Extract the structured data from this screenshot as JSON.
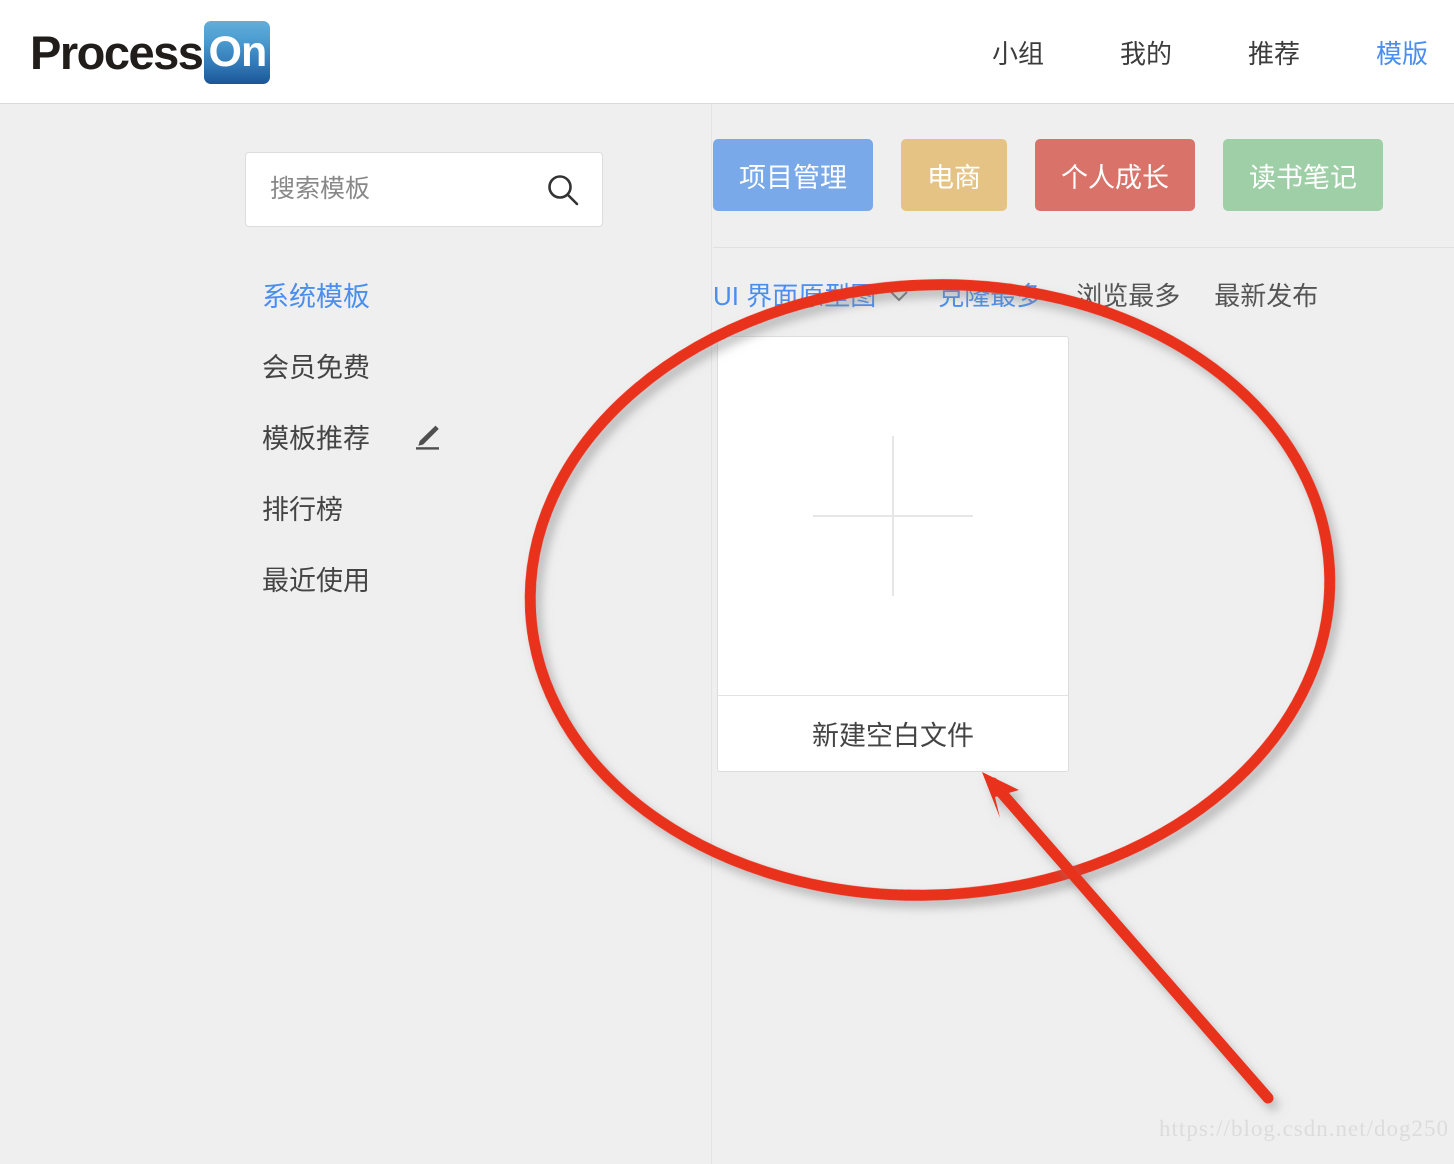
{
  "header": {
    "logo": {
      "word": "Process",
      "badge": "On"
    },
    "nav": [
      {
        "label": "小组",
        "active": false
      },
      {
        "label": "我的",
        "active": false
      },
      {
        "label": "推荐",
        "active": false
      },
      {
        "label": "模版",
        "active": true
      }
    ]
  },
  "sidebar": {
    "search": {
      "placeholder": "搜索模板",
      "value": "",
      "icon": "search-icon"
    },
    "items": [
      {
        "label": "系统模板",
        "active": true,
        "icon": null
      },
      {
        "label": "会员免费",
        "active": false,
        "icon": null
      },
      {
        "label": "模板推荐",
        "active": false,
        "icon": "pencil-icon"
      },
      {
        "label": "排行榜",
        "active": false,
        "icon": null
      },
      {
        "label": "最近使用",
        "active": false,
        "icon": null
      }
    ]
  },
  "main": {
    "chips": [
      {
        "label": "项目管理",
        "color": "#79a9e8"
      },
      {
        "label": "电商",
        "color": "#e5c384"
      },
      {
        "label": "个人成长",
        "color": "#d9736a"
      },
      {
        "label": "读书笔记",
        "color": "#9ecfa6"
      }
    ],
    "category_select": {
      "label": "UI 界面原型图",
      "icon": "chevron-down-icon"
    },
    "sort_filters": [
      {
        "label": "克隆最多",
        "active": true
      },
      {
        "label": "浏览最多",
        "active": false
      },
      {
        "label": "最新发布",
        "active": false
      }
    ],
    "card": {
      "label": "新建空白文件",
      "thumb_icon": "plus-icon"
    }
  },
  "annotation": {
    "ellipse_color": "#e8301d",
    "arrow_color": "#e8301d"
  },
  "watermark": "https://blog.csdn.net/dog250",
  "colors": {
    "page_bg": "#efefef",
    "header_bg": "#ffffff",
    "accent_blue": "#4a8ef0"
  }
}
